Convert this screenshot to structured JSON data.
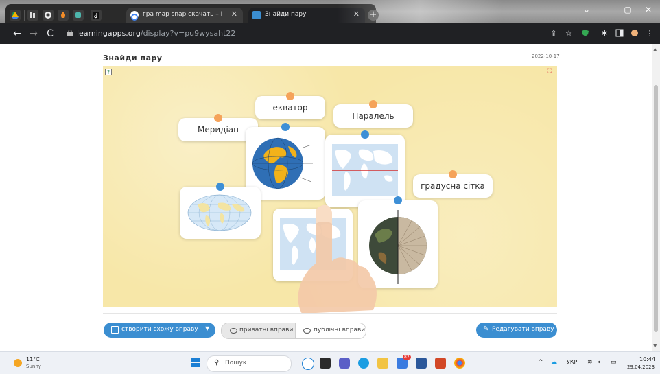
{
  "browser": {
    "tabs": [
      {
        "title": "гра map snap скачать – Пошук",
        "active": false
      },
      {
        "title": "Знайди пару",
        "active": true
      }
    ],
    "new_tab": "+",
    "url_host": "learningapps.org",
    "url_path": "/display?v=pu9wysaht22",
    "window_controls": {
      "minimize": "–",
      "maximize": "▢",
      "close": "✕",
      "dropdown": "⌄"
    }
  },
  "app": {
    "title": "Знайди пару",
    "date": "2022-10-17",
    "cards": {
      "ekvator": "екватор",
      "meridian": "Меридіан",
      "paralel": "Паралель",
      "hradusna": "градусна сітка"
    }
  },
  "footer": {
    "create_similar": "створити схожу вправу",
    "private": "приватні вправи",
    "public": "публічні вправи",
    "edit": "Редагувати вправу"
  },
  "taskbar": {
    "temperature": "11°C",
    "condition": "Sunny",
    "search_placeholder": "Пошук",
    "language": "УКР",
    "time": "10:44",
    "date": "29.04.2023",
    "badge": "82"
  },
  "colors": {
    "accent_blue": "#3b8ed1",
    "stage_yellow": "#f7e7a8",
    "dot_orange": "#f5a35a",
    "dot_blue": "#3d8fd6"
  }
}
